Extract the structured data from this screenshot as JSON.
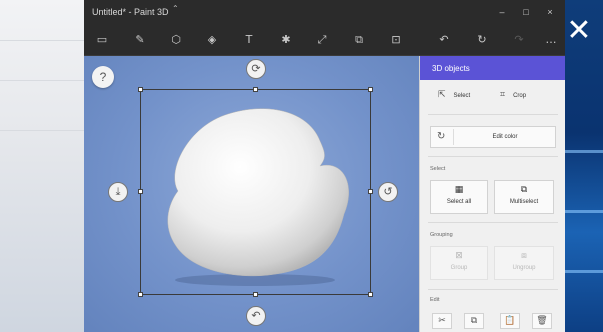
{
  "window": {
    "title": "Untitled* - Paint 3D",
    "minimize": "–",
    "maximize": "□",
    "close": "×"
  },
  "toolbar": {
    "tools": [
      {
        "name": "brushes",
        "glyph": "▭"
      },
      {
        "name": "pen",
        "glyph": "✎"
      },
      {
        "name": "3d-shapes",
        "glyph": "⬡"
      },
      {
        "name": "2d-shapes",
        "glyph": "◈"
      },
      {
        "name": "text",
        "glyph": "T"
      },
      {
        "name": "effects",
        "glyph": "✱"
      },
      {
        "name": "canvas",
        "glyph": "⤢"
      },
      {
        "name": "stickers",
        "glyph": "⧉"
      },
      {
        "name": "remix",
        "glyph": "⊡"
      },
      {
        "name": "undo",
        "glyph": "↶"
      },
      {
        "name": "history",
        "glyph": "↻"
      },
      {
        "name": "redo",
        "glyph": "↷"
      },
      {
        "name": "more",
        "glyph": "…"
      }
    ]
  },
  "canvas": {
    "help_label": "?"
  },
  "desktop": {
    "close_glyph": "✕"
  },
  "panel": {
    "header": "3D objects",
    "select_label": "Select",
    "crop_label": "Crop",
    "edit_color_label": "Edit color",
    "section_select": "Select",
    "select_all_label": "Select all",
    "multiselect_label": "Multiselect",
    "section_grouping": "Grouping",
    "group_label": "Group",
    "ungroup_label": "Ungroup",
    "section_edit": "Edit"
  },
  "colors": {
    "accent": "#5b53d6",
    "titlebar": "#2b2b2b",
    "canvas": "#7392ca"
  }
}
